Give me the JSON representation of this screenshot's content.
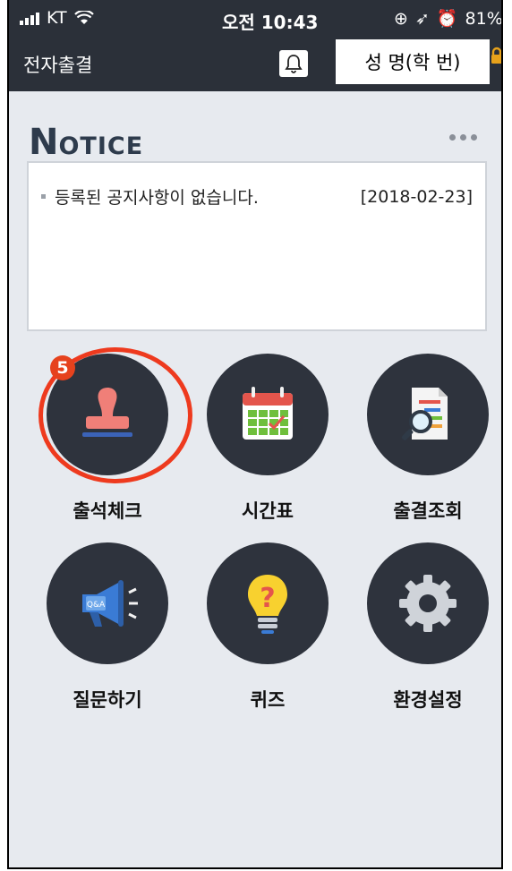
{
  "status_bar": {
    "carrier": "KT",
    "time": "오전 10:43",
    "battery": "81%",
    "battery_level": 0.81
  },
  "app_bar": {
    "title": "전자출결",
    "user": "성 명(학 번)"
  },
  "notice": {
    "title_first": "N",
    "title_rest": "OTICE",
    "items": [
      {
        "text": "등록된 공지사항이 없습니다.",
        "date": "[2018-02-23]"
      }
    ]
  },
  "menu": [
    {
      "label": "출석체크",
      "icon": "stamp-icon",
      "badge": "5"
    },
    {
      "label": "시간표",
      "icon": "calendar-icon"
    },
    {
      "label": "출결조회",
      "icon": "document-search-icon"
    },
    {
      "label": "질문하기",
      "icon": "megaphone-qa-icon"
    },
    {
      "label": "퀴즈",
      "icon": "lightbulb-question-icon"
    },
    {
      "label": "환경설정",
      "icon": "gear-icon"
    }
  ],
  "colors": {
    "header_bg": "#2b3039",
    "page_bg": "#e7eaef",
    "circle_bg": "#2e333d",
    "highlight": "#ee3a1e"
  }
}
